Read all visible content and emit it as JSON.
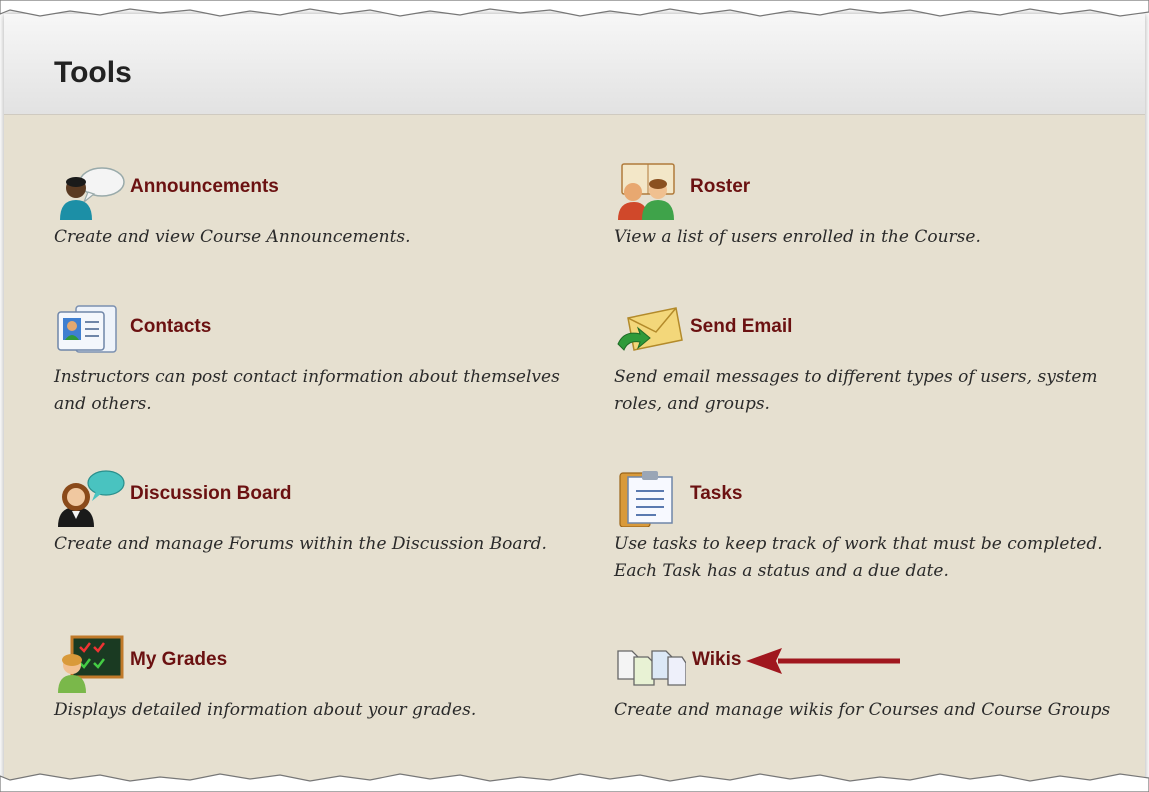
{
  "page": {
    "title": "Tools"
  },
  "tools": [
    {
      "name": "Announcements",
      "description": "Create and view Course Announcements.",
      "icon": "announcements-icon"
    },
    {
      "name": "Roster",
      "description": "View a list of users enrolled in the Course.",
      "icon": "roster-icon"
    },
    {
      "name": "Contacts",
      "description": "Instructors can post contact information about themselves and others.",
      "icon": "contacts-icon"
    },
    {
      "name": "Send Email",
      "description": "Send email messages to different types of users, system roles, and groups.",
      "icon": "send-email-icon"
    },
    {
      "name": "Discussion Board",
      "description": "Create and manage Forums within the Discussion Board.",
      "icon": "discussion-board-icon"
    },
    {
      "name": "Tasks",
      "description": "Use tasks to keep track of work that must be completed. Each Task has a status and a due date.",
      "icon": "tasks-icon"
    },
    {
      "name": "My Grades",
      "description": "Displays detailed information about your grades.",
      "icon": "my-grades-icon"
    },
    {
      "name": "Wikis",
      "description": "Create and manage wikis for Courses and Course Groups",
      "icon": "wikis-icon"
    }
  ],
  "annotation": {
    "arrow_color": "#a0171e",
    "points_to": "Wikis"
  },
  "colors": {
    "link": "#6b1111",
    "background": "#e6e0d0",
    "header": "#ececec"
  }
}
